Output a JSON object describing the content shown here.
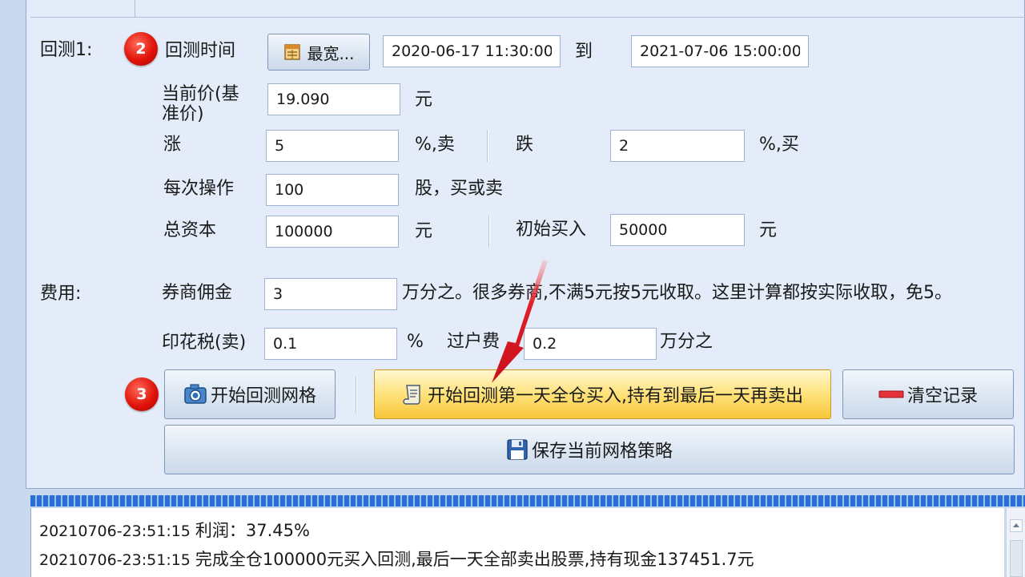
{
  "backtest": {
    "section_label": "回测1:",
    "step_badge": "2",
    "time_label": "回测时间",
    "widest_button_label": "最宽...",
    "start_time": "2020-06-17 11:30:00",
    "to_label": "到",
    "end_time": "2021-07-06 15:00:00",
    "current_price_label_line1": "当前价(基",
    "current_price_label_line2": "准价)",
    "current_price_value": "19.090",
    "yuan_unit_1": "元",
    "rise_label": "涨",
    "rise_value": "5",
    "rise_unit": "%,卖",
    "fall_label": "跌",
    "fall_value": "2",
    "fall_unit": "%,买",
    "per_op_label": "每次操作",
    "per_op_value": "100",
    "per_op_unit": "股，买或卖",
    "capital_label": "总资本",
    "capital_value": "100000",
    "capital_unit": "元",
    "initial_buy_label": "初始买入",
    "initial_buy_value": "50000",
    "initial_buy_unit": "元"
  },
  "fees": {
    "section_label": "费用:",
    "commission_label": "券商佣金",
    "commission_value": "3",
    "commission_note": "万分之。很多券商,不满5元按5元收取。这里计算都按实际收取，免5。",
    "stamp_tax_label": "印花税(卖)",
    "stamp_tax_value": "0.1",
    "stamp_tax_unit": "%",
    "transfer_fee_label": "过户费",
    "transfer_fee_value": "0.2",
    "transfer_fee_unit": "万分之"
  },
  "actions": {
    "step_badge": "3",
    "start_grid_label": "开始回测网格",
    "start_full_label": "开始回测第一天全仓买入,持有到最后一天再卖出",
    "clear_label": "清空记录",
    "save_label": "保存当前网格策略"
  },
  "log": {
    "lines": [
      {
        "time": "20210706-23:51:15",
        "message": "利润：37.45%"
      },
      {
        "time": "20210706-23:51:15",
        "message": "完成全仓100000元买入回测,最后一天全部卖出股票,持有现金137451.7元"
      }
    ]
  },
  "colors": {
    "panel_bg": "#e3ecf8",
    "gold_button": "#f7c63a",
    "badge_red": "#e0140a",
    "arrow_red": "#e0202a"
  }
}
